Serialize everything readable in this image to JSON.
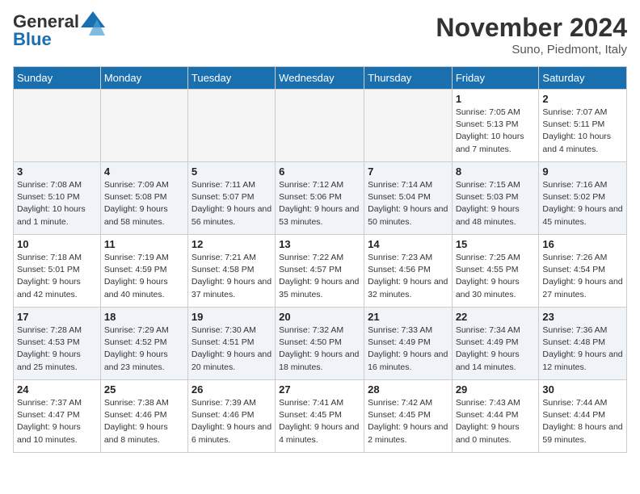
{
  "header": {
    "logo_general": "General",
    "logo_blue": "Blue",
    "month_title": "November 2024",
    "location": "Suno, Piedmont, Italy"
  },
  "weekdays": [
    "Sunday",
    "Monday",
    "Tuesday",
    "Wednesday",
    "Thursday",
    "Friday",
    "Saturday"
  ],
  "weeks": [
    [
      {
        "day": "",
        "info": ""
      },
      {
        "day": "",
        "info": ""
      },
      {
        "day": "",
        "info": ""
      },
      {
        "day": "",
        "info": ""
      },
      {
        "day": "",
        "info": ""
      },
      {
        "day": "1",
        "info": "Sunrise: 7:05 AM\nSunset: 5:13 PM\nDaylight: 10 hours and 7 minutes."
      },
      {
        "day": "2",
        "info": "Sunrise: 7:07 AM\nSunset: 5:11 PM\nDaylight: 10 hours and 4 minutes."
      }
    ],
    [
      {
        "day": "3",
        "info": "Sunrise: 7:08 AM\nSunset: 5:10 PM\nDaylight: 10 hours and 1 minute."
      },
      {
        "day": "4",
        "info": "Sunrise: 7:09 AM\nSunset: 5:08 PM\nDaylight: 9 hours and 58 minutes."
      },
      {
        "day": "5",
        "info": "Sunrise: 7:11 AM\nSunset: 5:07 PM\nDaylight: 9 hours and 56 minutes."
      },
      {
        "day": "6",
        "info": "Sunrise: 7:12 AM\nSunset: 5:06 PM\nDaylight: 9 hours and 53 minutes."
      },
      {
        "day": "7",
        "info": "Sunrise: 7:14 AM\nSunset: 5:04 PM\nDaylight: 9 hours and 50 minutes."
      },
      {
        "day": "8",
        "info": "Sunrise: 7:15 AM\nSunset: 5:03 PM\nDaylight: 9 hours and 48 minutes."
      },
      {
        "day": "9",
        "info": "Sunrise: 7:16 AM\nSunset: 5:02 PM\nDaylight: 9 hours and 45 minutes."
      }
    ],
    [
      {
        "day": "10",
        "info": "Sunrise: 7:18 AM\nSunset: 5:01 PM\nDaylight: 9 hours and 42 minutes."
      },
      {
        "day": "11",
        "info": "Sunrise: 7:19 AM\nSunset: 4:59 PM\nDaylight: 9 hours and 40 minutes."
      },
      {
        "day": "12",
        "info": "Sunrise: 7:21 AM\nSunset: 4:58 PM\nDaylight: 9 hours and 37 minutes."
      },
      {
        "day": "13",
        "info": "Sunrise: 7:22 AM\nSunset: 4:57 PM\nDaylight: 9 hours and 35 minutes."
      },
      {
        "day": "14",
        "info": "Sunrise: 7:23 AM\nSunset: 4:56 PM\nDaylight: 9 hours and 32 minutes."
      },
      {
        "day": "15",
        "info": "Sunrise: 7:25 AM\nSunset: 4:55 PM\nDaylight: 9 hours and 30 minutes."
      },
      {
        "day": "16",
        "info": "Sunrise: 7:26 AM\nSunset: 4:54 PM\nDaylight: 9 hours and 27 minutes."
      }
    ],
    [
      {
        "day": "17",
        "info": "Sunrise: 7:28 AM\nSunset: 4:53 PM\nDaylight: 9 hours and 25 minutes."
      },
      {
        "day": "18",
        "info": "Sunrise: 7:29 AM\nSunset: 4:52 PM\nDaylight: 9 hours and 23 minutes."
      },
      {
        "day": "19",
        "info": "Sunrise: 7:30 AM\nSunset: 4:51 PM\nDaylight: 9 hours and 20 minutes."
      },
      {
        "day": "20",
        "info": "Sunrise: 7:32 AM\nSunset: 4:50 PM\nDaylight: 9 hours and 18 minutes."
      },
      {
        "day": "21",
        "info": "Sunrise: 7:33 AM\nSunset: 4:49 PM\nDaylight: 9 hours and 16 minutes."
      },
      {
        "day": "22",
        "info": "Sunrise: 7:34 AM\nSunset: 4:49 PM\nDaylight: 9 hours and 14 minutes."
      },
      {
        "day": "23",
        "info": "Sunrise: 7:36 AM\nSunset: 4:48 PM\nDaylight: 9 hours and 12 minutes."
      }
    ],
    [
      {
        "day": "24",
        "info": "Sunrise: 7:37 AM\nSunset: 4:47 PM\nDaylight: 9 hours and 10 minutes."
      },
      {
        "day": "25",
        "info": "Sunrise: 7:38 AM\nSunset: 4:46 PM\nDaylight: 9 hours and 8 minutes."
      },
      {
        "day": "26",
        "info": "Sunrise: 7:39 AM\nSunset: 4:46 PM\nDaylight: 9 hours and 6 minutes."
      },
      {
        "day": "27",
        "info": "Sunrise: 7:41 AM\nSunset: 4:45 PM\nDaylight: 9 hours and 4 minutes."
      },
      {
        "day": "28",
        "info": "Sunrise: 7:42 AM\nSunset: 4:45 PM\nDaylight: 9 hours and 2 minutes."
      },
      {
        "day": "29",
        "info": "Sunrise: 7:43 AM\nSunset: 4:44 PM\nDaylight: 9 hours and 0 minutes."
      },
      {
        "day": "30",
        "info": "Sunrise: 7:44 AM\nSunset: 4:44 PM\nDaylight: 8 hours and 59 minutes."
      }
    ]
  ]
}
